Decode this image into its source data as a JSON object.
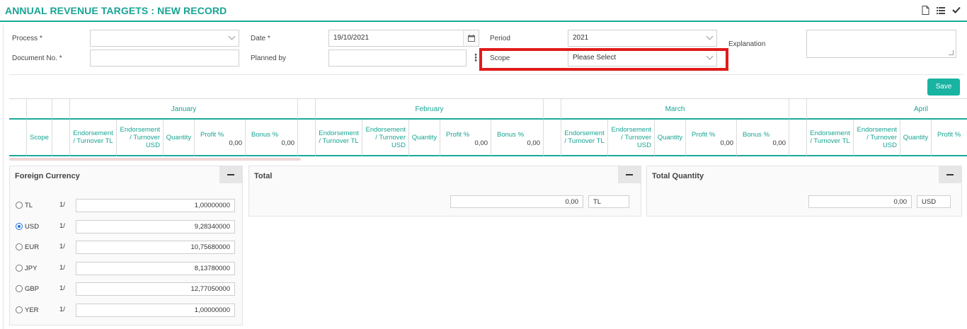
{
  "header": {
    "title": "ANNUAL REVENUE TARGETS : NEW RECORD",
    "icons": [
      "document-icon",
      "list-icon",
      "check-icon"
    ]
  },
  "form": {
    "process_label": "Process *",
    "process_value": "",
    "document_no_label": "Document No. *",
    "document_no_value": "",
    "date_label": "Date *",
    "date_value": "19/10/2021",
    "planned_by_label": "Planned by",
    "planned_by_value": "",
    "period_label": "Period",
    "period_value": "2021",
    "scope_label": "Scope",
    "scope_value": "Please Select",
    "explanation_label": "Explanation",
    "explanation_value": ""
  },
  "save_label": "Save",
  "grid": {
    "months": [
      "January",
      "February",
      "March",
      "April"
    ],
    "scope_header": "Scope",
    "col_endorsement_tl": "Endorsement / Turnover TL",
    "col_endorsement_usd": "Endorsement / Turnover USD",
    "col_quantity": "Quantity",
    "col_profit": "Profit %",
    "col_bonus": "Bonus %",
    "profit_value": "0,00",
    "bonus_value": "0,00"
  },
  "foreign_currency": {
    "title": "Foreign Currency",
    "rows": [
      {
        "code": "TL",
        "prefix": "1/",
        "value": "1,00000000",
        "selected": false
      },
      {
        "code": "USD",
        "prefix": "1/",
        "value": "9,28340000",
        "selected": true
      },
      {
        "code": "EUR",
        "prefix": "1/",
        "value": "10,75680000",
        "selected": false
      },
      {
        "code": "JPY",
        "prefix": "1/",
        "value": "8,13780000",
        "selected": false
      },
      {
        "code": "GBP",
        "prefix": "1/",
        "value": "12,77050000",
        "selected": false
      },
      {
        "code": "YER",
        "prefix": "1/",
        "value": "1,00000000",
        "selected": false
      }
    ]
  },
  "total": {
    "title": "Total",
    "value": "0,00",
    "currency": "TL"
  },
  "total_quantity": {
    "title": "Total Quantity",
    "value": "0,00",
    "currency": "USD"
  },
  "colors": {
    "accent": "#17a493",
    "highlight": "#e01b1b",
    "save": "#19b3a1"
  }
}
